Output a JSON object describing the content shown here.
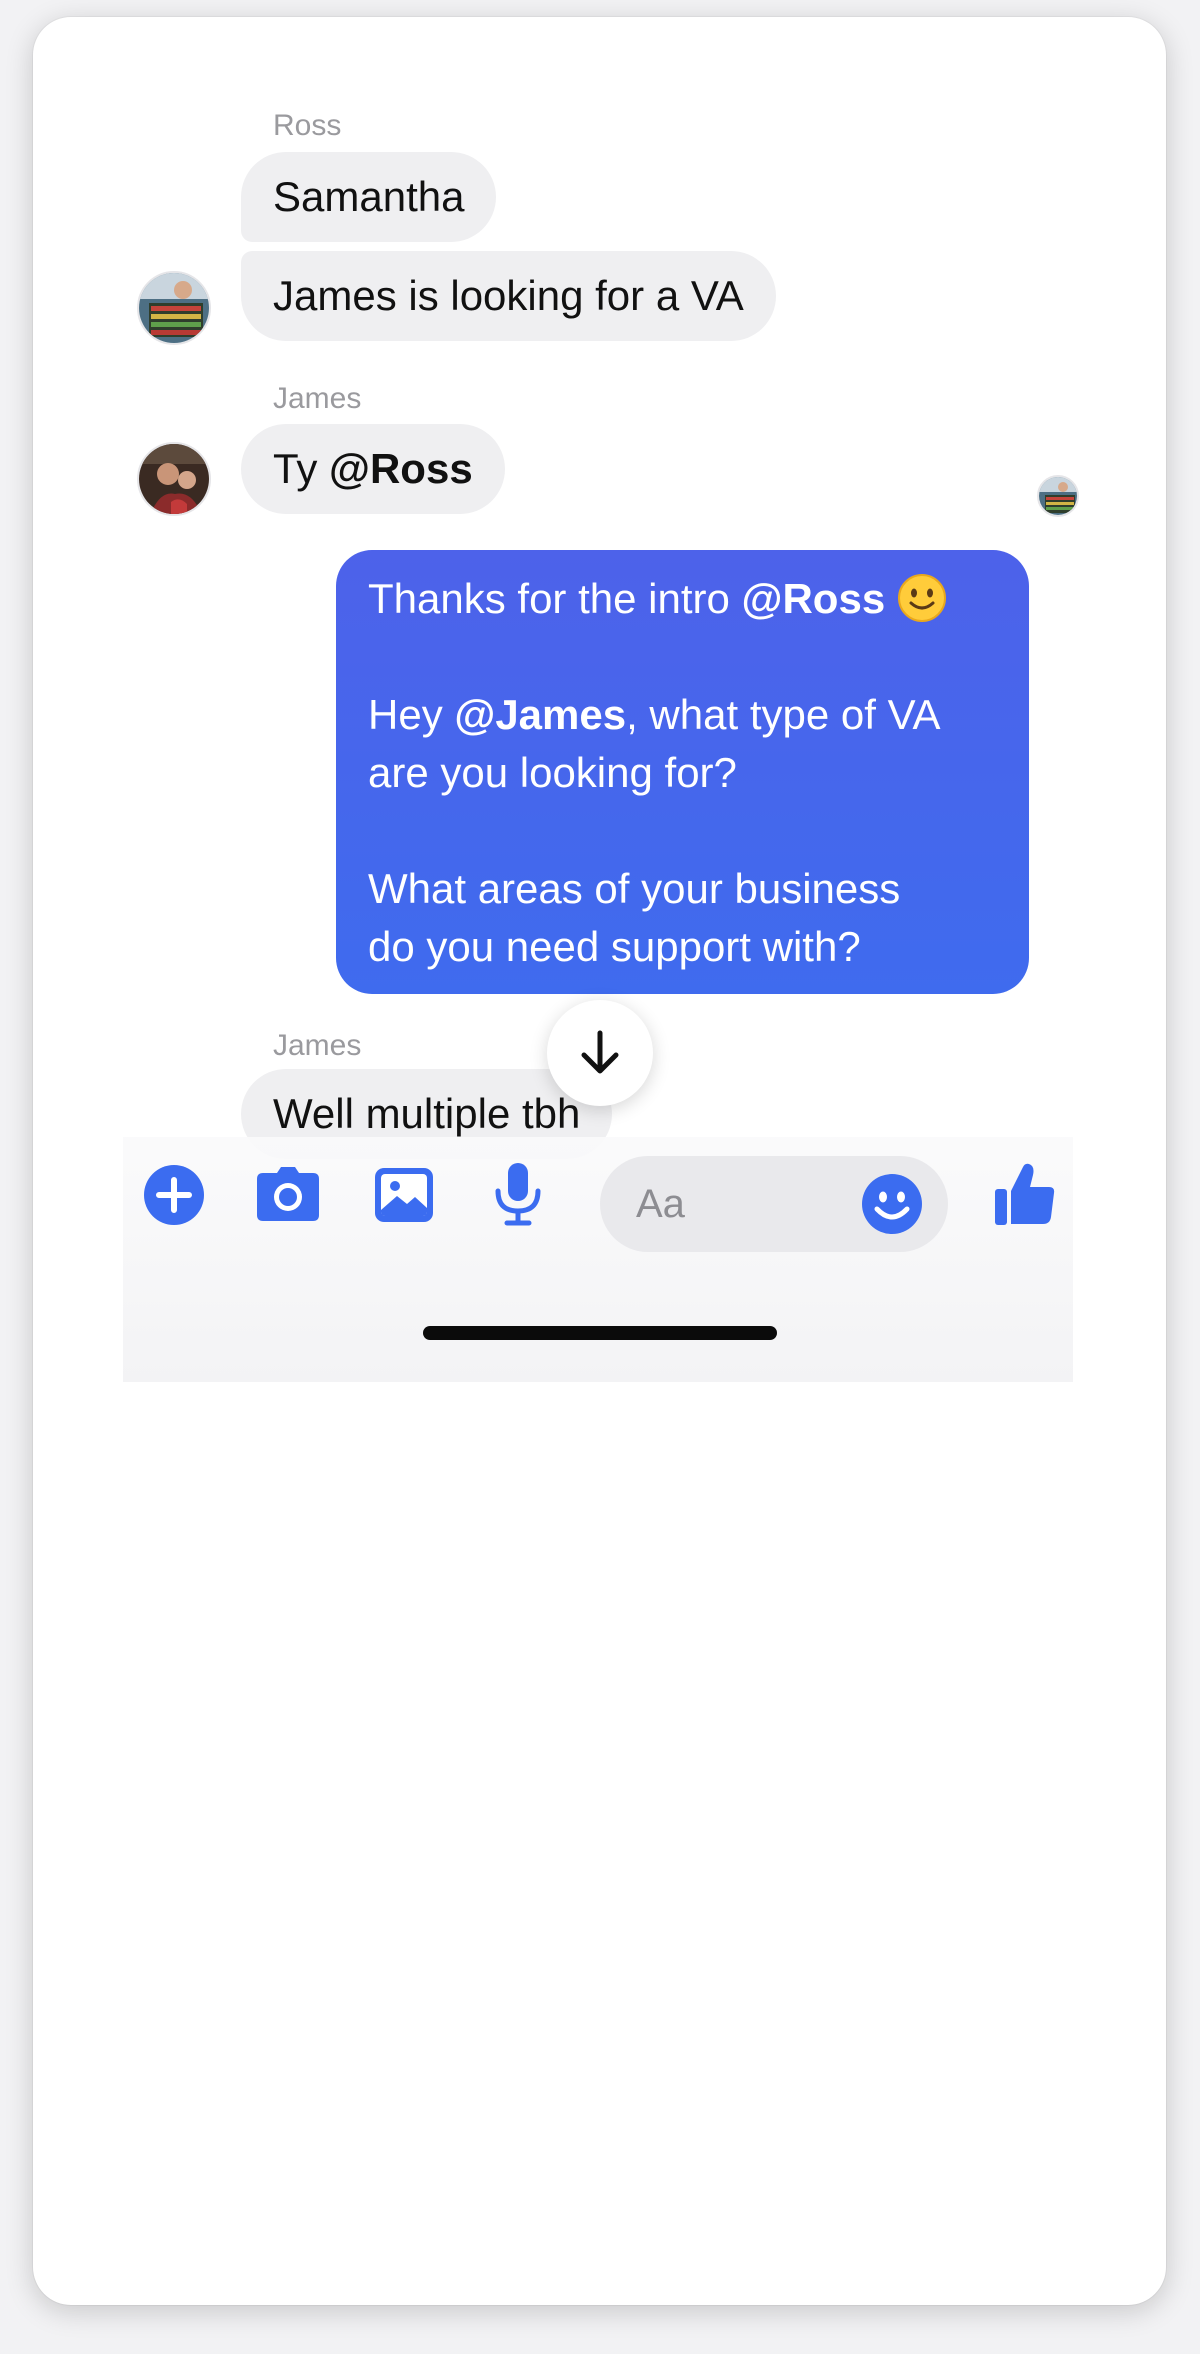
{
  "colors": {
    "accent": "#3b6cf0",
    "outgoing_bubble": "#4767ec",
    "incoming_bubble": "#efeff1"
  },
  "messages": [
    {
      "sender": "Ross",
      "bubbles": [
        "Samantha",
        "James is looking for a VA"
      ]
    },
    {
      "sender": "James",
      "bubbles": [
        {
          "prefix": "Ty ",
          "mention": "@Ross"
        }
      ]
    },
    {
      "sender": "me",
      "lines": {
        "l1_pre": "Thanks for the intro ",
        "l1_mention": "@Ross",
        "l1_emoji": "slightly-smiling-emoji",
        "l2_pre": "Hey ",
        "l2_mention": "@James",
        "l2_post": ", what type of VA",
        "l3": "are you looking for?",
        "l4": "What areas of your business",
        "l5": "do you need support with?"
      }
    },
    {
      "sender": "James",
      "bubbles": [
        "Well multiple tbh"
      ]
    }
  ],
  "composer": {
    "placeholder": "Aa",
    "icons": [
      "plus-icon",
      "camera-icon",
      "image-icon",
      "microphone-icon",
      "emoji-icon",
      "thumbs-up-icon"
    ]
  },
  "scroll_button_icon": "arrow-down-icon"
}
